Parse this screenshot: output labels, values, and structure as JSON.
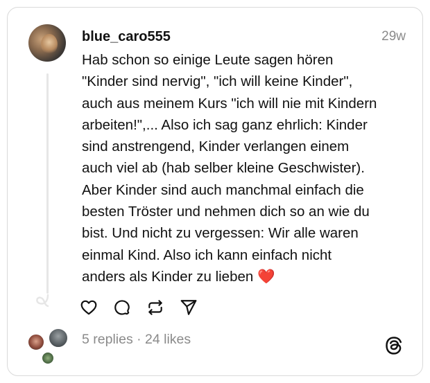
{
  "post": {
    "username": "blue_caro555",
    "timestamp": "29w",
    "text_lines": [
      "Hab schon so einige Leute sagen hören",
      "\"Kinder sind nervig\", \"ich will keine Kinder\",",
      "auch aus meinem Kurs \"ich will nie mit Kindern",
      "arbeiten!\",... Also ich sag ganz ehrlich: Kinder",
      "sind anstrengend, Kinder verlangen einem",
      "auch viel ab (hab selber kleine Geschwister).",
      "Aber Kinder sind auch manchmal einfach die",
      "besten Tröster und nehmen dich so an wie du",
      "bist. Und nicht zu vergessen: Wir alle waren",
      "einmal Kind. Also ich kann einfach nicht",
      "anders als Kinder zu lieben"
    ],
    "emoji": "❤️"
  },
  "actions": {
    "icons": [
      "heart-icon",
      "comment-icon",
      "repost-icon",
      "share-icon"
    ]
  },
  "stats": {
    "summary": "5 replies · 24 likes"
  },
  "colors": {
    "text": "#111111",
    "muted": "#8a8a8a",
    "border": "#d9d9d9",
    "heart": "#e0245e"
  }
}
